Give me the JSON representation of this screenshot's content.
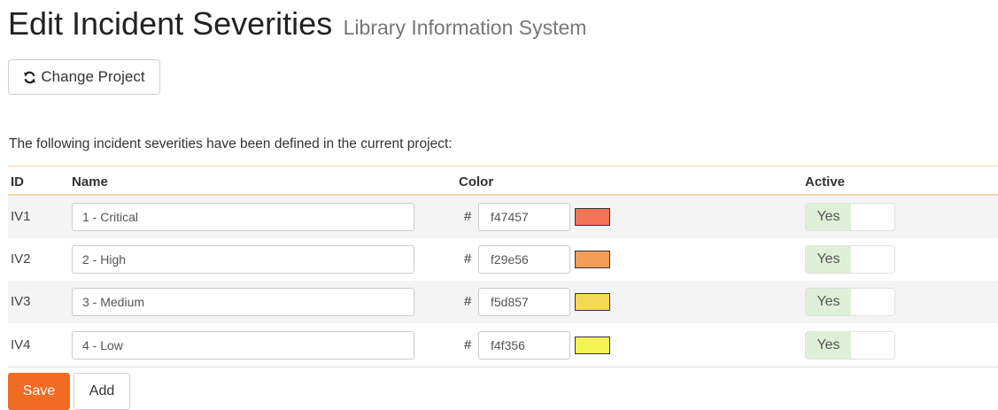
{
  "header": {
    "title": "Edit Incident Severities",
    "subtitle": "Library Information System"
  },
  "toolbar": {
    "change_project_label": "Change Project",
    "change_project_icon": "refresh-icon"
  },
  "intro_text": "The following incident severities have been defined in the current project:",
  "table": {
    "columns": [
      "ID",
      "Name",
      "Color",
      "Active"
    ],
    "color_prefix": "#",
    "rows": [
      {
        "id": "IV1",
        "name": "1 - Critical",
        "color": "f47457",
        "active": "Yes"
      },
      {
        "id": "IV2",
        "name": "2 - High",
        "color": "f29e56",
        "active": "Yes"
      },
      {
        "id": "IV3",
        "name": "3 - Medium",
        "color": "f5d857",
        "active": "Yes"
      },
      {
        "id": "IV4",
        "name": "4 - Low",
        "color": "f4f356",
        "active": "Yes"
      }
    ]
  },
  "actions": {
    "save_label": "Save",
    "add_label": "Add"
  },
  "colors": {
    "accent": "#f26b22",
    "header_border": "#f5d6a6",
    "active_on_bg": "#dff0d8"
  }
}
